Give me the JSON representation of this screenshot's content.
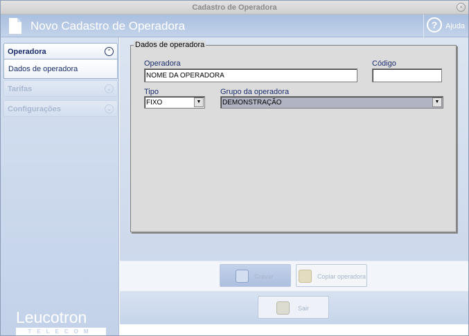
{
  "window": {
    "title": "Cadastro de Operadora",
    "close_glyph": "×"
  },
  "header": {
    "title": "Novo Cadastro de Operadora",
    "help_label": "Ajuda",
    "help_glyph": "?"
  },
  "sidebar": {
    "panels": [
      {
        "label": "Operadora",
        "expanded": true,
        "items": [
          "Dados de operadora"
        ],
        "chevron": "⌃"
      },
      {
        "label": "Tarifas",
        "expanded": false,
        "chevron": "⌄"
      },
      {
        "label": "Configurações",
        "expanded": false,
        "chevron": "⌄"
      }
    ],
    "brand": {
      "name": "Leucotron",
      "sub": "TELECOM"
    }
  },
  "form": {
    "group_title": "Dados de operadora",
    "operadora": {
      "label": "Operadora",
      "value": "NOME DA OPERADORA"
    },
    "codigo": {
      "label": "Código",
      "value": ""
    },
    "tipo": {
      "label": "Tipo",
      "value": "FIXO"
    },
    "grupo": {
      "label": "Grupo da operadora",
      "value": "DEMONSTRAÇÃO"
    },
    "dropdown_arrow": "▼"
  },
  "buttons": {
    "gravar": "Gravar",
    "copiar": "Copiar operadora",
    "sair": "Sair"
  },
  "colors": {
    "header": "#a9bfdf",
    "sidebar": "#c3d2e9",
    "accent_text": "#1a2d6b"
  }
}
